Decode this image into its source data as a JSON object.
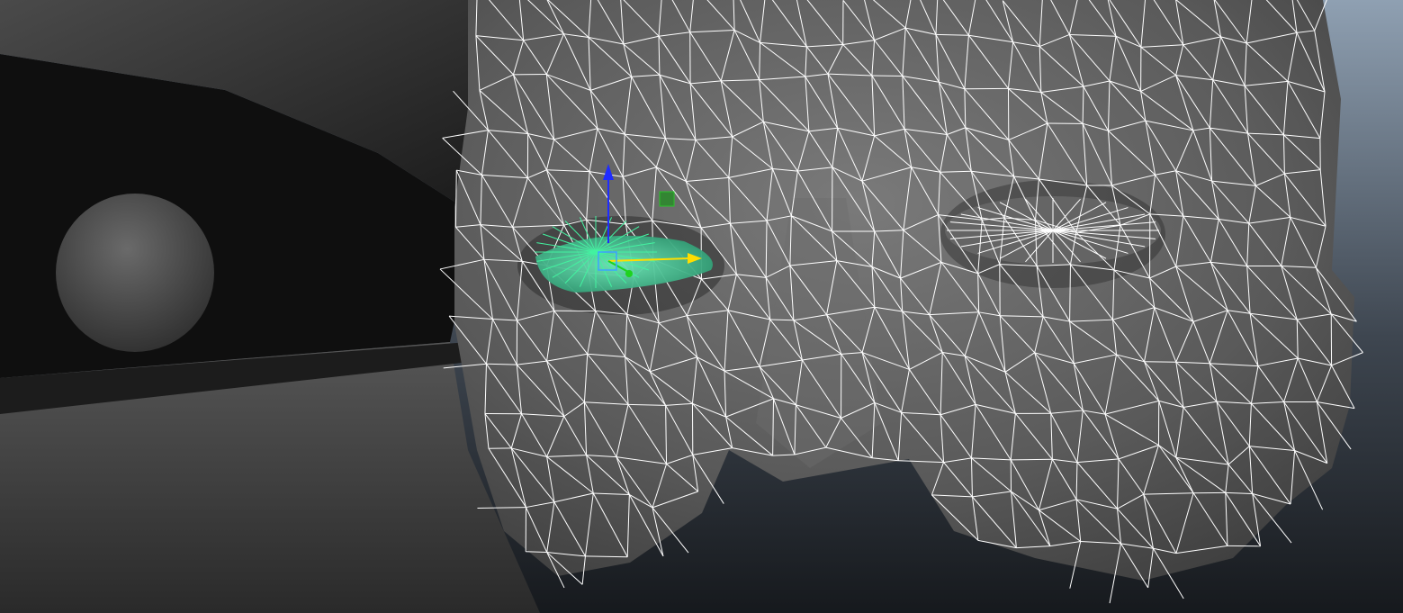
{
  "viewport": {
    "background_top": "#8fa0b2",
    "background_bottom": "#16191d",
    "wireframe_color": "#ffffff",
    "selection_color": "#43f2a0",
    "shading": "smooth-shaded-with-wireframe"
  },
  "objects": [
    {
      "name": "head-mesh",
      "state": "wireframe-on-shaded"
    },
    {
      "name": "left-eye-mesh",
      "state": "selected"
    },
    {
      "name": "right-eye-mesh",
      "state": "unselected"
    },
    {
      "name": "pupil-sphere",
      "state": "unselected"
    },
    {
      "name": "eyelid-shell",
      "state": "unselected"
    }
  ],
  "manipulator": {
    "tool": "move-tool",
    "x_axis_color": "#ffdd00",
    "y_axis_color": "#1f2cff",
    "z_axis_color": "#1fd21f",
    "center_color": "#3aa5ff"
  }
}
